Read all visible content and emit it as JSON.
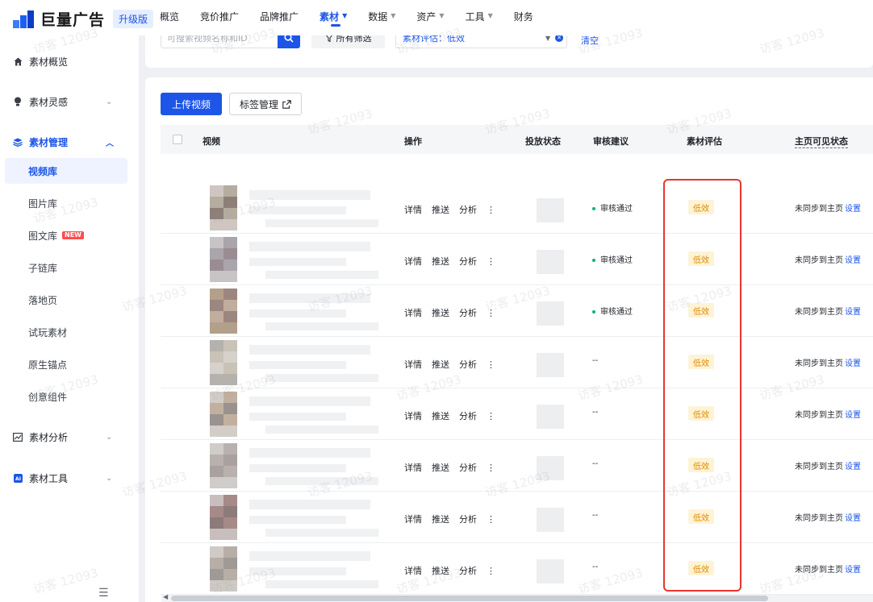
{
  "brand": {
    "logo_text": "巨量广告",
    "upgrade_label": "升级版"
  },
  "topnav": [
    {
      "label": "概览",
      "caret": false,
      "active": false
    },
    {
      "label": "竞价推广",
      "caret": false,
      "active": false
    },
    {
      "label": "品牌推广",
      "caret": false,
      "active": false
    },
    {
      "label": "素材",
      "caret": true,
      "active": true
    },
    {
      "label": "数据",
      "caret": true,
      "active": false
    },
    {
      "label": "资产",
      "caret": true,
      "active": false
    },
    {
      "label": "工具",
      "caret": true,
      "active": false
    },
    {
      "label": "财务",
      "caret": false,
      "active": false
    }
  ],
  "sidebar": {
    "overview": "素材概览",
    "inspiration": "素材灵感",
    "management": "素材管理",
    "sub_items": [
      {
        "label": "视频库"
      },
      {
        "label": "图片库"
      },
      {
        "label": "图文库",
        "badge": "NEW"
      },
      {
        "label": "子链库"
      },
      {
        "label": "落地页"
      },
      {
        "label": "试玩素材"
      },
      {
        "label": "原生锚点"
      },
      {
        "label": "创意组件"
      }
    ],
    "analysis": "素材分析",
    "tools": "素材工具"
  },
  "filters": {
    "search_placeholder": "可搜索视频名称和ID",
    "all_filters": "所有筛选",
    "eval_filter": "素材评估：低效",
    "clear": "清空"
  },
  "toolbar": {
    "upload": "上传视频",
    "tag_manage": "标签管理"
  },
  "table": {
    "headers": {
      "video": "视频",
      "ops": "操作",
      "delivery": "投放状态",
      "audit": "审核建议",
      "eval": "素材评估",
      "visibility": "主页可见状态"
    },
    "rows": [
      {
        "ops": [
          "详情",
          "推送",
          "分析"
        ],
        "audit": "审核通过",
        "audit_passed": true,
        "eval": "低效",
        "visibility": "未同步到主页",
        "set": "设置"
      },
      {
        "ops": [
          "详情",
          "推送",
          "分析"
        ],
        "audit": "审核通过",
        "audit_passed": true,
        "eval": "低效",
        "visibility": "未同步到主页",
        "set": "设置"
      },
      {
        "ops": [
          "详情",
          "推送",
          "分析"
        ],
        "audit": "审核通过",
        "audit_passed": true,
        "eval": "低效",
        "visibility": "未同步到主页",
        "set": "设置"
      },
      {
        "ops": [
          "详情",
          "推送",
          "分析"
        ],
        "audit": "--",
        "audit_passed": false,
        "eval": "低效",
        "visibility": "未同步到主页",
        "set": "设置"
      },
      {
        "ops": [
          "详情",
          "推送",
          "分析"
        ],
        "audit": "--",
        "audit_passed": false,
        "eval": "低效",
        "visibility": "未同步到主页",
        "set": "设置"
      },
      {
        "ops": [
          "详情",
          "推送",
          "分析"
        ],
        "audit": "--",
        "audit_passed": false,
        "eval": "低效",
        "visibility": "未同步到主页",
        "set": "设置"
      },
      {
        "ops": [
          "详情",
          "推送",
          "分析"
        ],
        "audit": "--",
        "audit_passed": false,
        "eval": "低效",
        "visibility": "未同步到主页",
        "set": "设置"
      },
      {
        "ops": [
          "详情",
          "推送",
          "分析"
        ],
        "audit": "--",
        "audit_passed": false,
        "eval": "低效",
        "visibility": "未同步到主页",
        "set": "设置"
      }
    ]
  },
  "watermark": "访客 12093",
  "colors": {
    "primary": "#1c55e8",
    "low_badge_bg": "#fff3d6",
    "low_badge_text": "#e08a00",
    "highlight": "#e8362f",
    "audit_ok": "#00b578"
  }
}
